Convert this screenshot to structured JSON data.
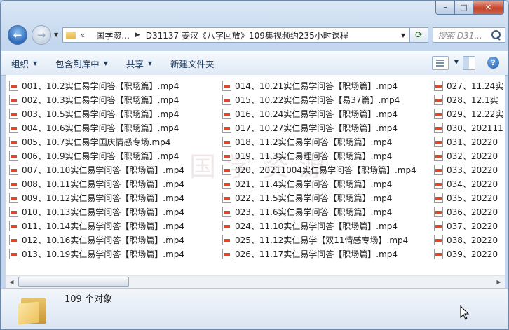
{
  "window": {
    "buttons": {
      "minimize": "–",
      "maximize": "□",
      "close": "✕"
    }
  },
  "nav": {
    "back_glyph": "←",
    "forward_glyph": "→",
    "address_prefix": "«",
    "breadcrumb": [
      "国学资...",
      "D31137 姜汉《八字回放》109集视频约235小时课程"
    ],
    "search_placeholder": "搜索 D31..."
  },
  "toolbar": {
    "organize": "组织",
    "include_in_library": "包含到库中",
    "share": "共享",
    "new_folder": "新建文件夹",
    "help": "?"
  },
  "watermark": "国学资源",
  "files": {
    "col1": [
      "001、10.2实仁易学问答【职场篇】.mp4",
      "002、10.3实仁易学问答【职场篇】.mp4",
      "003、10.5实仁易学问答【职场篇】.mp4",
      "004、10.6实仁易学问答【职场篇】.mp4",
      "005、10.7实仁易学国庆情感专场.mp4",
      "006、10.9实仁易学问答【职场篇】.mp4",
      "007、10.10实仁易学问答【职场篇】.mp4",
      "008、10.11实仁易学问答【职场篇】.mp4",
      "009、10.12实仁易学问答【职场篇】.mp4",
      "010、10.13实仁易学问答【职场篇】.mp4",
      "011、10.14实仁易学问答【职场篇】.mp4",
      "012、10.16实仁易学问答【职场篇】.mp4",
      "013、10.19实仁易学问答【职场篇】.mp4"
    ],
    "col2": [
      "014、10.21实仁易学问答【职场篇】.mp4",
      "015、10.22实仁易学问答【易37篇】.mp4",
      "016、10.24实仁易学问答【职场篇】.mp4",
      "017、10.27实仁易学问答【职场篇】.mp4",
      "018、11.2实仁易学问答【职场篇】.mp4",
      "019、11.3实仁易理问答【职场篇】.mp4",
      "020、20211004实仁易学问答【职场篇】.mp4",
      "021、11.4实仁易学问答【职场篇】.mp4",
      "022、11.5实仁易学问答【职场篇】.mp4",
      "023、11.6实仁易学问答【职场篇】.mp4",
      "024、11.10实仁易学问答【职场篇】.mp4",
      "025、11.12实仁易学【双11情感专场】.mp4",
      "026、11.17实仁易学问答【职场篇】.mp4"
    ],
    "col3": [
      "027、11.24实",
      "028、12.1实",
      "029、12.22实",
      "030、202111",
      "031、20220",
      "032、20220",
      "033、20220",
      "034、20220",
      "035、20220",
      "036、20220",
      "037、20220",
      "038、20220",
      "039、20220"
    ]
  },
  "status": {
    "count": "109 个对象"
  }
}
